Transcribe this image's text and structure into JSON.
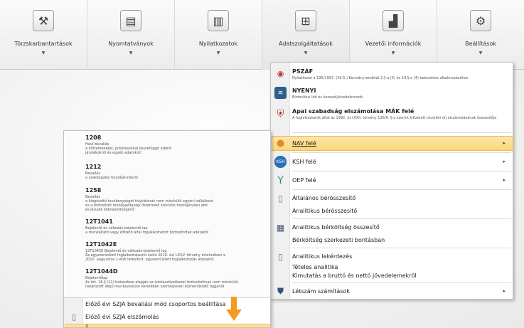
{
  "ribbon": [
    {
      "label": "Törzskarbantartások",
      "icon": "tools-icon",
      "glyph": "⚒"
    },
    {
      "label": "Nyomtatványok",
      "icon": "printer-icon",
      "glyph": "▤"
    },
    {
      "label": "Nyilatkozatok",
      "icon": "clipboard-icon",
      "glyph": "▥"
    },
    {
      "label": "Adatszolgáltatások",
      "icon": "network-icon",
      "glyph": "⊞"
    },
    {
      "label": "Vezetői információk",
      "icon": "chart-icon",
      "glyph": "▟"
    },
    {
      "label": "Beállítások",
      "icon": "gears-icon",
      "glyph": "⚙"
    }
  ],
  "ribbon_arrow": "▼",
  "right_menu": {
    "header_items": [
      {
        "title": "PSZÁF",
        "desc": "Nyilatkozat a 195/1997. (XII.5.) Kormányrendelet 2.§-a (3) és 19.§-a (4) bekezdése alkalmazásához",
        "icon": "pszaf-logo-icon"
      },
      {
        "title": "NYENYI",
        "desc": "Biztosítási idő és kereset/jövedelemadó",
        "icon": "nyenyi-icon"
      },
      {
        "title": "Apai szabadság elszámolása MÁK felé",
        "desc": "A foglalkoztatók által az 1992. évi XXII. törvény 138/A. §-a szerint kifizetett távolléti díj elszámolásának összesítője",
        "icon": "hungary-coat-icon"
      }
    ],
    "submenus": [
      {
        "label": "NAV felé",
        "icon": "nav-logo-icon"
      },
      {
        "label": "KSH felé",
        "icon": "ksh-logo-icon"
      },
      {
        "label": "OEP felé",
        "icon": "oep-logo-icon"
      }
    ],
    "submenu_arrow": "▸",
    "commands": [
      {
        "label": "Általános bérösszesítő",
        "icon": "document-icon"
      },
      {
        "label": "Analitikus bérösszesítő",
        "icon": ""
      },
      {
        "label": "Analitikus bérköltség összesítő",
        "icon": "calculator-icon"
      },
      {
        "label": "Bérköltség szerkezeti bontásban",
        "icon": ""
      },
      {
        "label": "Analitikus lekérdezés",
        "icon": "document-icon"
      },
      {
        "label": "Tételes analitika",
        "icon": ""
      },
      {
        "label": "Kimutatás a bruttó és nettó jövedelemekről",
        "icon": ""
      }
    ],
    "last_item": {
      "label": "Létszám számítások",
      "icon": "shield-icon"
    }
  },
  "left_menu": {
    "forms": [
      {
        "code": "1208",
        "desc": [
          "Havi bevallás",
          "a kifizetésekkel, juttatásokkal összefüggő adóról",
          "járulékokról és egyéb adatokról"
        ]
      },
      {
        "code": "1212",
        "desc": [
          "Bevallás",
          "a szakképzési hozzájárulásról"
        ]
      },
      {
        "code": "1258",
        "desc": [
          "Bevallás",
          "a kiegészítő tevékenységet folytatónak nem minősülő egyéni vállalkozó",
          "és a biztosított mezőgazdasági őstermelő szociális hozzájárulási adó",
          "és járulék kötelezettségéről"
        ]
      },
      {
        "code": "12T1041",
        "desc": [
          "Bejelentő és változás-bejelentő lap",
          "a munkáltató vagy kifizető által foglalkoztatott biztosítottak adatairól"
        ]
      },
      {
        "code": "12T1042E",
        "desc": [
          "12T1042E Bejelentő és változás-bejelentő lap",
          "Az egyszerűsített foglalkoztatásról szóló 2010. évi LXXV. törvény értelmében a",
          "2010. augusztus 1-étől létesített, egyszerűsített foglalkoztatás adatairól"
        ]
      },
      {
        "code": "12T1044D",
        "desc": [
          "Bejelentőlap",
          "Az Art. 16.§ (11) bekezdése alapján az iskolaszövetkezet biztosítottnak nem minősülő,",
          "határozott idejű munkaviszony keretében személyesen közreműködő tagjairól"
        ]
      }
    ],
    "commands": [
      {
        "label": "Előző évi SZJA bevallási mód csoportos beállítása",
        "icon": ""
      },
      {
        "label": "Előző évi SZJA elszámolás",
        "icon": "document-icon"
      }
    ],
    "peek": "1"
  },
  "colors": {
    "highlight": "#f9d67a",
    "arrow": "#f59a1e"
  }
}
